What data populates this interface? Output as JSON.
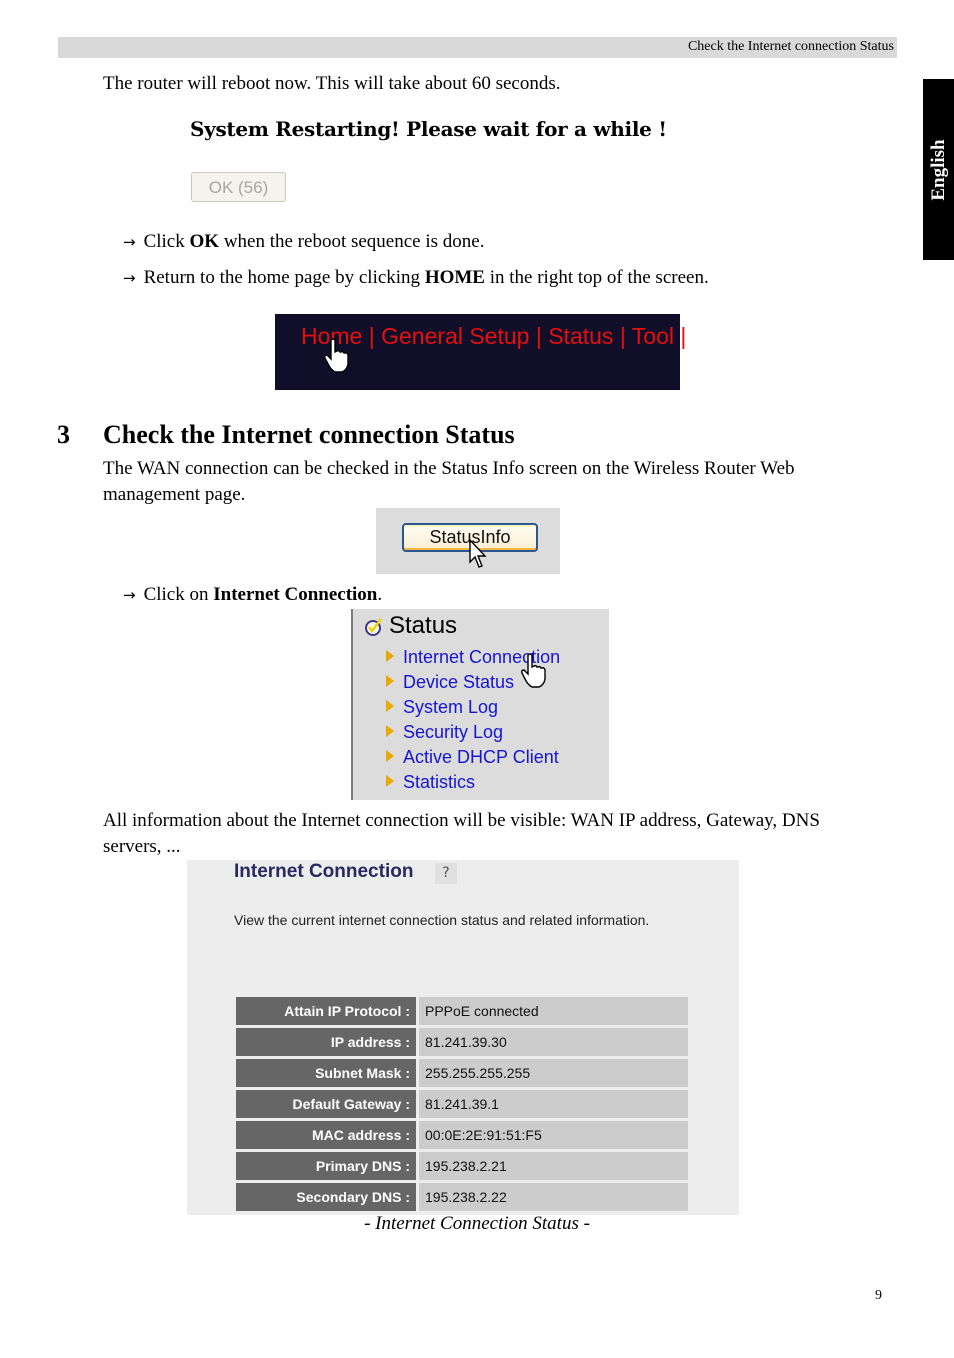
{
  "header": {
    "running_title": "Check the Internet connection Status"
  },
  "side_tab": {
    "label": "English"
  },
  "intro": {
    "text": "The router will reboot now. This will take about 60 seconds."
  },
  "restart_screen": {
    "message": "System Restarting! Please wait for a while !",
    "ok_button": "OK (56)"
  },
  "steps_1": [
    {
      "arrow": "→",
      "before": "Click ",
      "bold": "OK",
      "after": " when the reboot sequence is done."
    },
    {
      "arrow": "→",
      "before": "Return to the home page by clicking ",
      "bold": "HOME",
      "after": " in the right top of the screen."
    }
  ],
  "navbar": {
    "items": [
      "Home",
      "General Setup",
      "Status",
      "Tool"
    ],
    "separator": " | "
  },
  "section": {
    "number": "3",
    "title": "Check the Internet connection Status",
    "paragraph_line1": "The WAN connection can be checked in the Status Info screen on the Wireless Router Web",
    "paragraph_line2": "management page."
  },
  "statusinfo_button": {
    "label": "StatusInfo"
  },
  "steps_2": [
    {
      "arrow": "→",
      "before": "Click on ",
      "bold": "Internet Connection",
      "after": "."
    }
  ],
  "status_menu": {
    "title": "Status",
    "items": [
      "Internet Connection",
      "Device Status",
      "System Log",
      "Security Log",
      "Active DHCP Client",
      "Statistics"
    ]
  },
  "info_paragraph": {
    "line1": "All information about the Internet connection will be visible: WAN IP address, Gateway, DNS",
    "line2": "servers, ..."
  },
  "internet_connection": {
    "title": "Internet Connection",
    "help_icon": "?",
    "description": "View the current internet connection status and related information.",
    "rows": [
      {
        "label": "Attain IP Protocol :",
        "value": "PPPoE connected"
      },
      {
        "label": "IP address :",
        "value": "81.241.39.30"
      },
      {
        "label": "Subnet Mask :",
        "value": "255.255.255.255"
      },
      {
        "label": "Default Gateway :",
        "value": "81.241.39.1"
      },
      {
        "label": "MAC address :",
        "value": "00:0E:2E:91:51:F5"
      },
      {
        "label": "Primary DNS :",
        "value": "195.238.2.21"
      },
      {
        "label": "Secondary DNS :",
        "value": "195.238.2.22"
      }
    ]
  },
  "caption": "- Internet Connection Status -",
  "page_number": "9",
  "colors": {
    "nav_bg": "#110e2a",
    "nav_text": "#e60f0f",
    "menu_link": "#1515d6",
    "table_label_bg": "#666666",
    "table_value_bg": "#cccccc",
    "ic_title": "#2a2a62"
  }
}
